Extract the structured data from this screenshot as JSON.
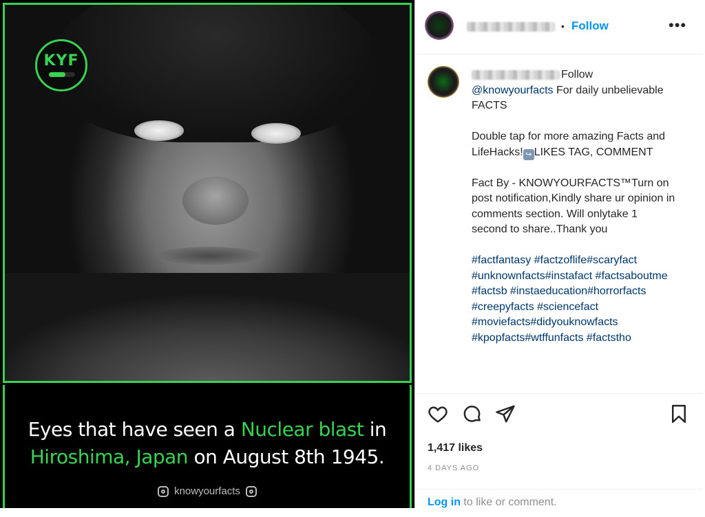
{
  "post_image": {
    "logo_text": "KYF",
    "caption_line1": {
      "a": "Eyes that have seen a ",
      "b": "Nuclear blast",
      "c": " in"
    },
    "caption_line2": {
      "a": "Hiroshima, Japan",
      "b": " on August 8th 1945."
    },
    "handle": "knowyourfacts",
    "accent_color": "#39d353"
  },
  "header": {
    "dot": "•",
    "follow_label": "Follow",
    "more_label": "•••"
  },
  "caption": {
    "follow_label": "Follow",
    "mention": "@knowyourfacts",
    "intro": " For daily unbelievable FACTS",
    "line2a": "Double tap for more amazing Facts and LifeHacks!",
    "tap_icon": "↪",
    "line2b": "LIKES TAG, COMMENT",
    "line3": "Fact By - KNOWYOURFACTS™Turn on post notification,Kindly share ur opinion in comments section. Will onlytake 1 second to share..Thank you",
    "hashtags": "#factfantasy #factzoflife#scaryfact #unknownfacts#instafact #factsaboutme #factsb #instaeducation#horrorfacts #creepyfacts #sciencefact #moviefacts#didyouknowfacts #kpopfacts#wtffunfacts #factstho"
  },
  "actions": {
    "icons": [
      "heart-icon",
      "comment-icon",
      "share-icon",
      "bookmark-icon"
    ],
    "likes": "1,417 likes",
    "date": "4 DAYS AGO"
  },
  "login": {
    "link": "Log in",
    "rest": " to like or comment."
  }
}
